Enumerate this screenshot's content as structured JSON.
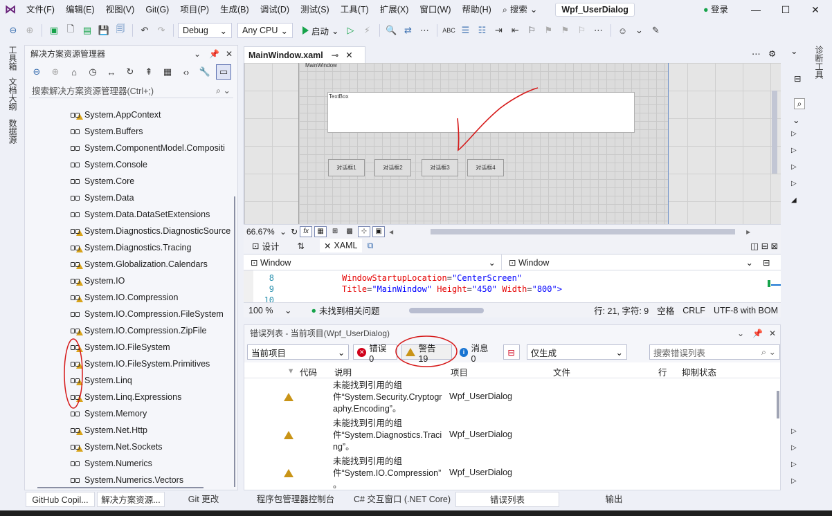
{
  "menubar": {
    "items": [
      "文件(F)",
      "编辑(E)",
      "视图(V)",
      "Git(G)",
      "项目(P)",
      "生成(B)",
      "调试(D)",
      "测试(S)",
      "工具(T)",
      "扩展(X)",
      "窗口(W)",
      "帮助(H)"
    ],
    "search": "搜索",
    "solution_name": "Wpf_UserDialog",
    "login": "登录"
  },
  "toolbar": {
    "config": "Debug",
    "platform": "Any CPU",
    "start": "启动"
  },
  "left_strip": [
    "工具箱",
    "文档大纲",
    "数据源"
  ],
  "solution_explorer": {
    "title": "解决方案资源管理器",
    "search_placeholder": "搜索解决方案资源管理器(Ctrl+;)",
    "items": [
      {
        "name": "System.AppContext",
        "warning": true
      },
      {
        "name": "System.Buffers",
        "warning": false
      },
      {
        "name": "System.ComponentModel.Compositi",
        "warning": false
      },
      {
        "name": "System.Console",
        "warning": false
      },
      {
        "name": "System.Core",
        "warning": false
      },
      {
        "name": "System.Data",
        "warning": false
      },
      {
        "name": "System.Data.DataSetExtensions",
        "warning": false
      },
      {
        "name": "System.Diagnostics.DiagnosticSource",
        "warning": true
      },
      {
        "name": "System.Diagnostics.Tracing",
        "warning": true
      },
      {
        "name": "System.Globalization.Calendars",
        "warning": true
      },
      {
        "name": "System.IO",
        "warning": true
      },
      {
        "name": "System.IO.Compression",
        "warning": true
      },
      {
        "name": "System.IO.Compression.FileSystem",
        "warning": false
      },
      {
        "name": "System.IO.Compression.ZipFile",
        "warning": true
      },
      {
        "name": "System.IO.FileSystem",
        "warning": true
      },
      {
        "name": "System.IO.FileSystem.Primitives",
        "warning": true
      },
      {
        "name": "System.Linq",
        "warning": true
      },
      {
        "name": "System.Linq.Expressions",
        "warning": true
      },
      {
        "name": "System.Memory",
        "warning": false
      },
      {
        "name": "System.Net.Http",
        "warning": true
      },
      {
        "name": "System.Net.Sockets",
        "warning": true
      },
      {
        "name": "System.Numerics",
        "warning": false
      },
      {
        "name": "System.Numerics.Vectors",
        "warning": false
      }
    ]
  },
  "bottom_tabs_left": [
    "GitHub Copil...",
    "解决方案资源...",
    "Git 更改"
  ],
  "editor": {
    "tab": "MainWindow.xaml",
    "window_label": "MainWindow",
    "textbox_label": "TextBox",
    "buttons": [
      "对话框1",
      "对话框2",
      "对话框3",
      "对话框4"
    ],
    "zoom": "66.67%",
    "design_tab": "设计",
    "xaml_tab": "XAML",
    "drop_left": "Window",
    "drop_right": "Window",
    "lines": [
      {
        "num": "8",
        "attr": "WindowStartupLocation",
        "val": "\"CenterScreen\""
      },
      {
        "num": "9",
        "attr1": "Title",
        "val1": "\"MainWindow\"",
        "attr2": "Height",
        "val2": "\"450\"",
        "attr3": "Width",
        "val3": "\"800\">"
      },
      {
        "num": "10"
      }
    ],
    "status": {
      "zoom": "100 %",
      "issues": "未找到相关问题",
      "position": "行: 21, 字符: 9",
      "space": "空格",
      "eol": "CRLF",
      "encoding": "UTF-8 with BOM"
    }
  },
  "error_list": {
    "title": "错误列表 - 当前项目(Wpf_UserDialog)",
    "scope": "当前项目",
    "errors": "错误 0",
    "warnings": "警告 19",
    "messages": "消息 0",
    "build_filter": "仅生成",
    "search_placeholder": "搜索错误列表",
    "columns": [
      "代码",
      "说明",
      "项目",
      "文件",
      "行",
      "抑制状态"
    ],
    "rows": [
      {
        "line1": "未能找到引用的组",
        "line2": "件“System.Security.Cryptogr",
        "line3": "aphy.Encoding”。",
        "project": "Wpf_UserDialog"
      },
      {
        "line1": "未能找到引用的组",
        "line2": "件“System.Diagnostics.Traci",
        "line3": "ng”。",
        "project": "Wpf_UserDialog"
      },
      {
        "line1": "未能找到引用的组",
        "line2": "件“System.IO.Compression”",
        "line3": "。",
        "project": "Wpf_UserDialog"
      }
    ]
  },
  "bottom_tabs_right": [
    "程序包管理器控制台",
    "C# 交互窗口 (.NET Core)",
    "错误列表",
    "输出"
  ],
  "right_strip": [
    "诊断工具"
  ]
}
